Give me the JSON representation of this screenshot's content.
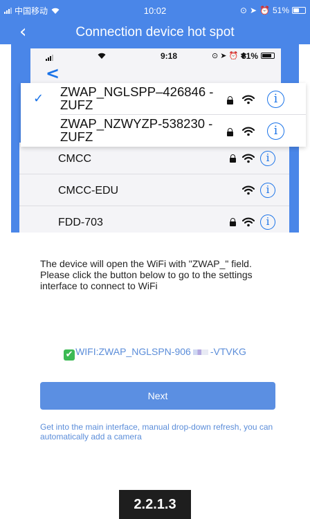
{
  "status_bar": {
    "carrier": "中国移动",
    "time": "10:02",
    "battery": "51%",
    "battery_level": 0.51
  },
  "nav": {
    "back_icon": "chevron-left-icon",
    "title": "Connection device hot spot"
  },
  "embedded_screenshot": {
    "status": {
      "time": "9:18",
      "battery": "81%",
      "battery_level": 0.81
    },
    "highlighted_networks": [
      {
        "name": "ZWAP_NGLSPP–426846 -ZUFZ",
        "checked": true,
        "locked": true
      },
      {
        "name": "ZWAP_NZWYZP-538230 -ZUFZ",
        "checked": false,
        "locked": true
      }
    ],
    "networks": [
      {
        "name": "CMCC",
        "locked": true
      },
      {
        "name": "CMCC-EDU",
        "locked": false
      },
      {
        "name": "FDD-703",
        "locked": true
      }
    ],
    "info_glyph": "i",
    "back_glyph": "<"
  },
  "instructions": "The device will open the WiFi with \"ZWAP_\" field. Please click the button below to go to the settings interface to connect to WiFi",
  "wifi_status": {
    "prefix": "WIFI:ZWAP_NGLSPN-906",
    "suffix": "-VTVKG",
    "check_icon": "green-check-icon"
  },
  "next_button": {
    "label": "Next"
  },
  "hint": "Get into the main interface, manual drop-down refresh, you can automatically add a camera",
  "step_label": "2.2.1.3",
  "colors": {
    "header_blue": "#4a86e8",
    "button_blue": "#5b8fe2",
    "link_blue": "#5b8dd9",
    "ios_blue": "#1a73e8",
    "success_green": "#3cba54"
  }
}
